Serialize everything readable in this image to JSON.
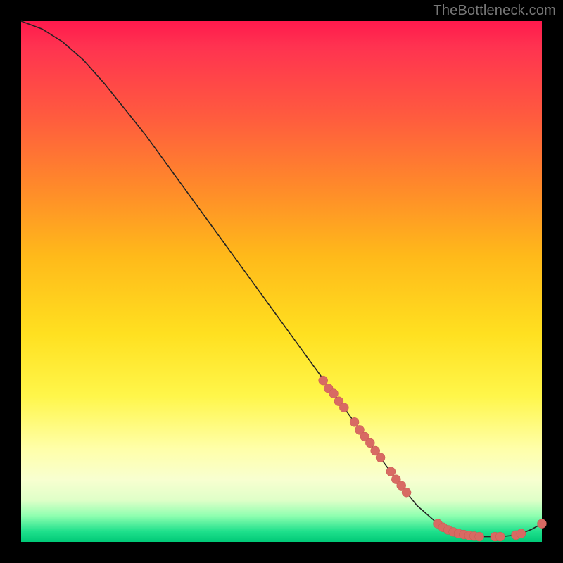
{
  "watermark": "TheBottleneck.com",
  "chart_data": {
    "type": "line",
    "title": "",
    "xlabel": "",
    "ylabel": "",
    "xlim": [
      0,
      100
    ],
    "ylim": [
      0,
      100
    ],
    "grid": false,
    "series": [
      {
        "name": "bottleneck-curve",
        "x": [
          0,
          4,
          8,
          12,
          16,
          20,
          24,
          28,
          32,
          36,
          40,
          44,
          48,
          52,
          56,
          60,
          64,
          68,
          72,
          76,
          80,
          82,
          84,
          86,
          88,
          90,
          92,
          94,
          96,
          98,
          100
        ],
        "y": [
          100,
          98.5,
          96,
          92.5,
          88,
          83,
          78,
          72.5,
          67,
          61.5,
          56,
          50.5,
          45,
          39.5,
          34,
          28.5,
          23,
          17.5,
          12,
          7,
          3.5,
          2.3,
          1.6,
          1.2,
          1.0,
          1.0,
          1.0,
          1.2,
          1.6,
          2.4,
          3.5
        ]
      }
    ],
    "markers": {
      "name": "gpu-points",
      "points": [
        {
          "x": 58,
          "y": 31
        },
        {
          "x": 59,
          "y": 29.5
        },
        {
          "x": 60,
          "y": 28.5
        },
        {
          "x": 61,
          "y": 27
        },
        {
          "x": 62,
          "y": 25.8
        },
        {
          "x": 64,
          "y": 23
        },
        {
          "x": 65,
          "y": 21.5
        },
        {
          "x": 66,
          "y": 20.2
        },
        {
          "x": 67,
          "y": 19
        },
        {
          "x": 68,
          "y": 17.5
        },
        {
          "x": 69,
          "y": 16.2
        },
        {
          "x": 71,
          "y": 13.5
        },
        {
          "x": 72,
          "y": 12
        },
        {
          "x": 73,
          "y": 10.8
        },
        {
          "x": 74,
          "y": 9.5
        },
        {
          "x": 80,
          "y": 3.5
        },
        {
          "x": 81,
          "y": 2.8
        },
        {
          "x": 82,
          "y": 2.3
        },
        {
          "x": 83,
          "y": 1.9
        },
        {
          "x": 84,
          "y": 1.6
        },
        {
          "x": 85,
          "y": 1.4
        },
        {
          "x": 86,
          "y": 1.2
        },
        {
          "x": 87,
          "y": 1.1
        },
        {
          "x": 88,
          "y": 1.0
        },
        {
          "x": 91,
          "y": 1.0
        },
        {
          "x": 92,
          "y": 1.0
        },
        {
          "x": 95,
          "y": 1.3
        },
        {
          "x": 96,
          "y": 1.6
        },
        {
          "x": 100,
          "y": 3.5
        }
      ]
    }
  }
}
